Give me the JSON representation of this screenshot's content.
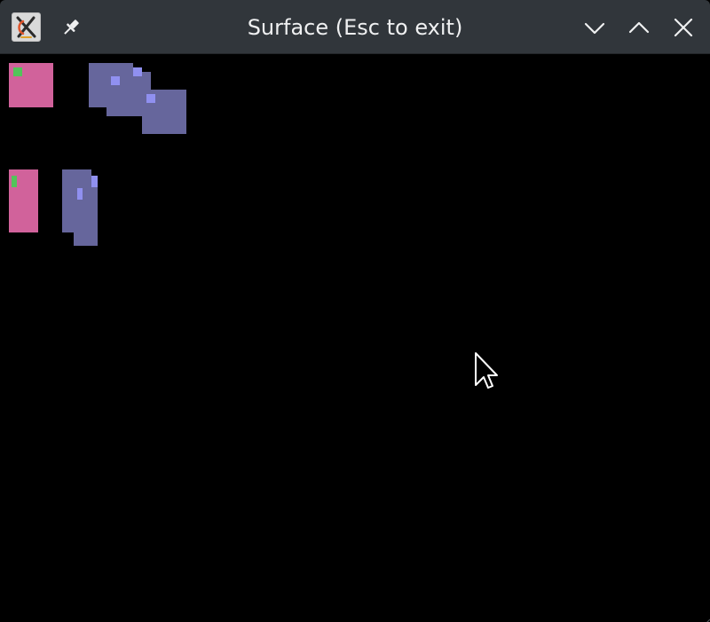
{
  "window": {
    "title": "Surface (Esc to exit)",
    "app_icon": "x-app-icon",
    "buttons": {
      "pin": "pin-icon",
      "minimize": "chevron-down-icon",
      "maximize": "chevron-up-icon",
      "close": "close-icon"
    }
  },
  "colors": {
    "titlebar": "#31363b",
    "title_text": "#eff0f1",
    "surface": "#000000",
    "pink": "#d1629b",
    "slate": "#66669c",
    "green": "#52c45a",
    "lilac": "#9090f0"
  }
}
